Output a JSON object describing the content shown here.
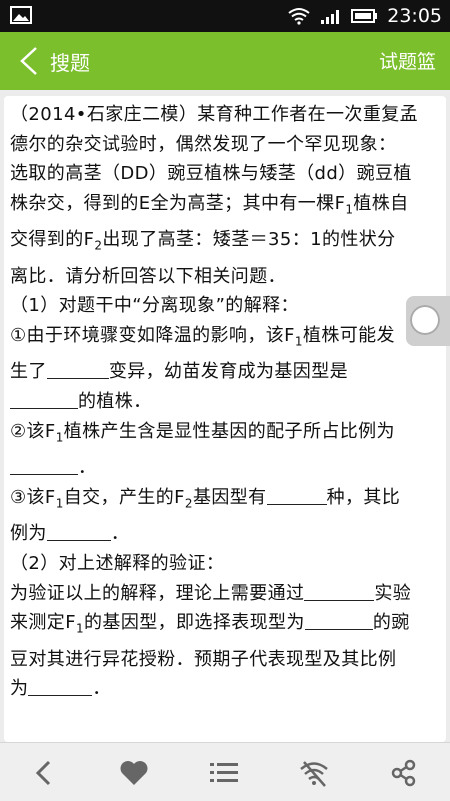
{
  "status_bar": {
    "time": "23:05",
    "icons": [
      "gallery-icon",
      "wifi-icon",
      "signal-icon",
      "battery-icon"
    ]
  },
  "app_bar": {
    "back_icon": "chevron-left-icon",
    "title": "搜题",
    "action": "试题篮"
  },
  "question": {
    "lines": [
      [
        "（2014•石家庄二模）某育种工作者在一次重复孟"
      ],
      [
        "德尔的杂交试验时，偶然发现了一个罕见现象："
      ],
      [
        "选取的高茎（DD）豌豆植株与矮茎（dd）豌豆植"
      ],
      [
        "株杂交，得到的E全为高茎；其中有一棵F",
        "1",
        "植株自"
      ],
      [
        "交得到的F",
        "2",
        "出现了高茎：矮茎＝35：1的性状分"
      ],
      [
        "离比．请分析回答以下相关问题．"
      ],
      [
        "（1）对题干中“分离现象”的解释："
      ],
      [
        "①由于环境骤变如降温的影响，该F",
        "1",
        "植株可能发"
      ],
      [
        "生了",
        "_",
        "变异，幼苗发育成为基因型是"
      ],
      [
        "_",
        "的植株．"
      ],
      [
        "②该F",
        "1",
        "植株产生含是显性基因的配子所占比例为"
      ],
      [
        "_",
        "．"
      ],
      [
        "③该F",
        "1",
        "自交，产生的F",
        "2",
        "基因型有",
        "_",
        "种，其比"
      ],
      [
        "例为",
        "_",
        "．"
      ],
      [
        "（2）对上述解释的验证："
      ],
      [
        "为验证以上的解释，理论上需要通过",
        "_",
        "实验"
      ],
      [
        "来测定F",
        "1",
        "的基因型，即选择表现型为",
        "_",
        "的豌"
      ],
      [
        "豆对其进行异花授粉．预期子代表现型及其比例"
      ],
      [
        "为",
        "_",
        "．"
      ]
    ]
  },
  "floating_button": {
    "icon": "assistive-touch-icon"
  },
  "bottom_nav": {
    "items": [
      {
        "icon": "back-arrow-icon"
      },
      {
        "icon": "heart-icon"
      },
      {
        "icon": "list-icon"
      },
      {
        "icon": "wifi-off-icon"
      },
      {
        "icon": "share-icon"
      }
    ]
  },
  "colors": {
    "accent": "#7cbf2c",
    "status_bar": "#111111",
    "background": "#ececec"
  }
}
